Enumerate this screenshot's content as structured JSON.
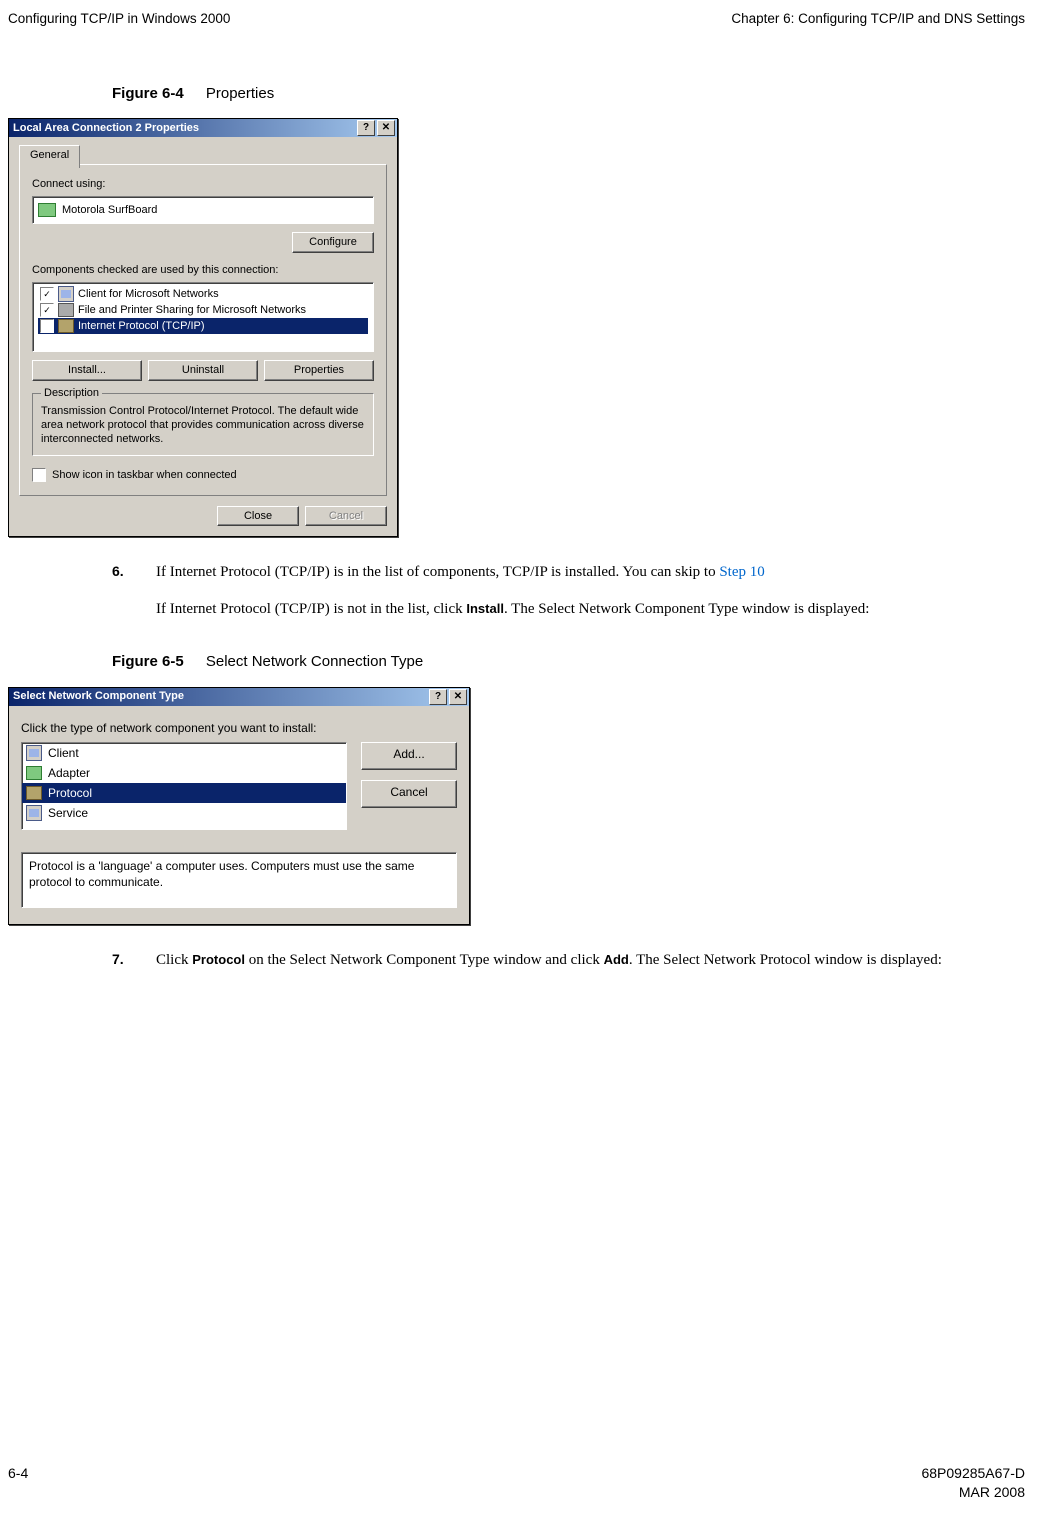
{
  "header": {
    "left": "Configuring TCP/IP in Windows 2000",
    "right": "Chapter 6: Configuring TCP/IP and DNS Settings"
  },
  "figure1": {
    "number": "Figure 6-4",
    "title": "Properties"
  },
  "dlg1": {
    "title": "Local Area Connection 2 Properties",
    "help_btn": "?",
    "close_btn": "✕",
    "tab": "General",
    "connect_label": "Connect using:",
    "adapter": "Motorola SurfBoard",
    "configure_btn": "Configure",
    "components_label": "Components checked are used by this connection:",
    "components": [
      {
        "checked": true,
        "label": "Client for Microsoft Networks",
        "icon": "monitor"
      },
      {
        "checked": true,
        "label": "File and Printer Sharing for Microsoft Networks",
        "icon": "printer"
      },
      {
        "checked": true,
        "label": "Internet Protocol (TCP/IP)",
        "icon": "proto",
        "selected": true
      }
    ],
    "install_btn": "Install...",
    "uninstall_btn": "Uninstall",
    "properties_btn": "Properties",
    "desc_legend": "Description",
    "desc_text": "Transmission Control Protocol/Internet Protocol. The default wide area network protocol that provides communication across diverse interconnected networks.",
    "show_icon_label": "Show icon in taskbar when connected",
    "close_btn2": "Close",
    "cancel_btn": "Cancel"
  },
  "step6": {
    "num": "6.",
    "line1_a": "If Internet Protocol (TCP/IP) is in the list of components, TCP/IP is installed. You can skip to ",
    "line1_link": "Step 10",
    "line2_a": "If Internet Protocol (TCP/IP) is not in the list, click ",
    "line2_bold": "Install",
    "line2_b": ". The Select Network Component Type window is displayed:"
  },
  "figure2": {
    "number": "Figure 6-5",
    "title": "Select Network Connection Type"
  },
  "dlg2": {
    "title": "Select Network Component Type",
    "help_btn": "?",
    "close_btn": "✕",
    "prompt": "Click the type of network component you want to install:",
    "types": [
      {
        "label": "Client",
        "icon": "monitor"
      },
      {
        "label": "Adapter",
        "icon": "net"
      },
      {
        "label": "Protocol",
        "icon": "proto",
        "selected": true
      },
      {
        "label": "Service",
        "icon": "monitor"
      }
    ],
    "add_btn": "Add...",
    "cancel_btn": "Cancel",
    "desc": "Protocol is a 'language' a computer uses. Computers must use the same protocol to communicate."
  },
  "step7": {
    "num": "7.",
    "a": "Click ",
    "b1": "Protocol",
    "c": " on the Select Network Component Type window and click ",
    "b2": "Add",
    "d": ". The Select Network Protocol window is displayed:"
  },
  "footer": {
    "page": "6-4",
    "docnum": "68P09285A67-D",
    "date": "MAR 2008"
  }
}
